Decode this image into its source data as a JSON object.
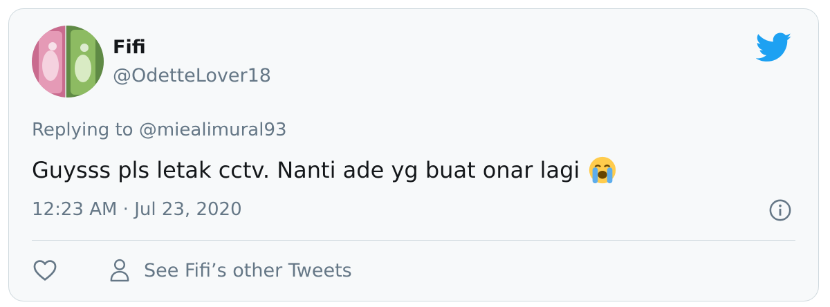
{
  "tweet": {
    "author_name": "Fifi",
    "author_handle": "@OdetteLover18",
    "replying_prefix": "Replying to",
    "replying_mention": "@miealimural93",
    "text": "Guysss pls letak cctv. Nanti ade yg buat onar lagi",
    "emoji": "😭",
    "timestamp": "12:23 AM · Jul 23, 2020"
  },
  "actions": {
    "other_tweets_label": "See Fifi’s other Tweets"
  },
  "icons": {
    "bird": "twitter-bird-icon",
    "info": "info-icon",
    "like": "heart-icon",
    "profile": "person-icon"
  },
  "colors": {
    "brand": "#1da1f2",
    "card_bg": "#f7f9fa",
    "secondary_text": "#657786",
    "primary_text": "#14171a",
    "border": "#cfd9de"
  }
}
